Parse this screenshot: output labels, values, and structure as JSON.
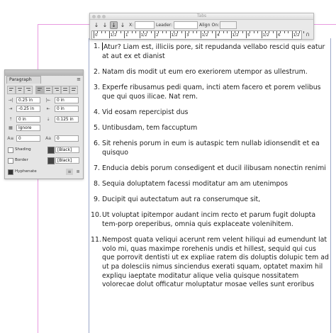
{
  "tabs_panel": {
    "title": "Tabs",
    "x_label": "X:",
    "leader_label": "Leader:",
    "align_on_label": "Align On:",
    "ruler_labels": [
      "0",
      "1/2",
      "1",
      "1/2",
      "2",
      "1/2",
      "3",
      "1/2",
      "4",
      "1/2",
      "5",
      "1/2",
      "6",
      "1/2"
    ]
  },
  "paragraph_panel": {
    "title": "Paragraph",
    "menu_icon": "hamburger-icon",
    "left_indent": "0.25 in",
    "first_line_indent": "-0.25 in",
    "space_before": "0 in",
    "drop_cap_lines": "0",
    "right_indent": "0 in",
    "last_line_right_indent": "0 in",
    "space_after": "0.125 in",
    "drop_cap_chars": "0",
    "align_to_grid": "Ignore",
    "shading_label": "Shading",
    "shading_color": "[Black]",
    "border_label": "Border",
    "border_color": "[Black]",
    "hyphenate_label": "Hyphenate"
  },
  "document": {
    "items": [
      {
        "num": "1.",
        "text": "Atur? Liam est, illiciis pore, sit repudanda vellabo rescid quis eatur at aut ex et dianist"
      },
      {
        "num": "2.",
        "text": "Natam dis modit ut eum ero exeriorem utempor as ullestrum."
      },
      {
        "num": "3.",
        "text": "Experfe ribusamus pedi quam, incti atem facero et porem velibus que qui quos ilicae. Nat rem."
      },
      {
        "num": "4.",
        "text": "Vid eosam repercipist dus"
      },
      {
        "num": "5.",
        "text": "Untibusdam, tem faccuptum"
      },
      {
        "num": "6.",
        "text": "Sit rehenis porum in eum is autaspic tem nullab idionsendit et ea quisquo"
      },
      {
        "num": "7.",
        "text": "Enducia debis porum consedigent et ducil ilibusam nonectin renimi"
      },
      {
        "num": "8.",
        "text": "Sequia doluptatem facessi moditatur am am utenimpos"
      },
      {
        "num": "9.",
        "text": "Ducipit qui autectatum aut ra conserumque sit,"
      },
      {
        "num": "10.",
        "text": "Ut voluptat ipitempor audant incim recto et parum fugit dolupta tem-porp oreperibus, omnia quis explaceate volenihitem."
      },
      {
        "num": "11.",
        "text": "Nempost quata veliqui acerunt rem velent hiliqui ad eumendunt lat volo mi, quas maximpe rorehenis undis et hillest, sequid qui cus que porrovit dentisti ut ex expliae ratem dis doluptis dolupic tem ad ut pa dolesciis nimus sinciendus exerati squam, optatet maxim hil expliqu iaeptate moditatur alique velia quisque nossitatem volorecae dolut officatur moluptatur mosae velles sunt eroribus"
      }
    ]
  }
}
